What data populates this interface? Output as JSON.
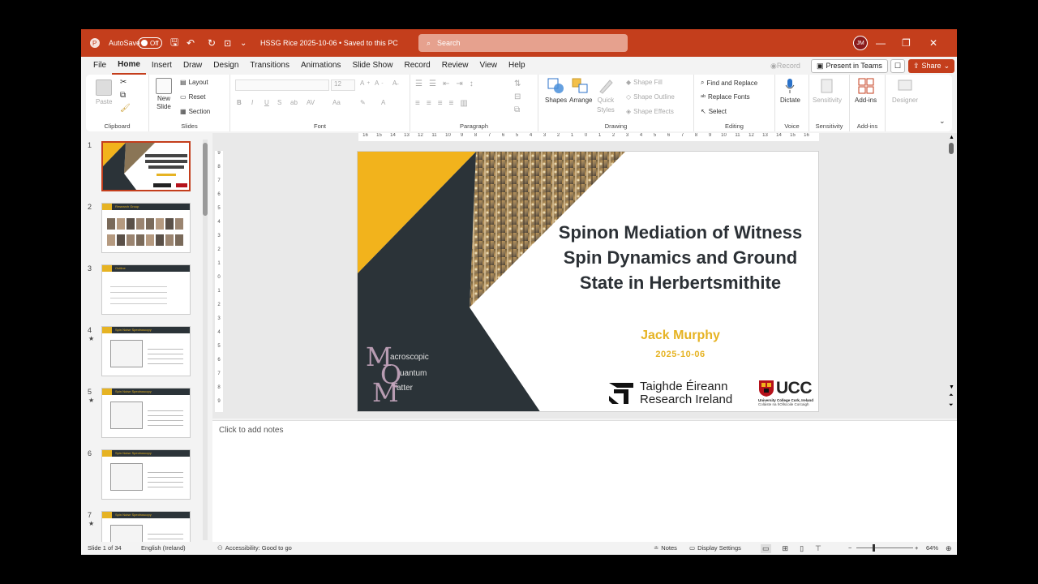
{
  "titlebar": {
    "autosave_label": "AutoSave",
    "autosave_state": "Off",
    "doc_title": "HSSG Rice 2025-10-06 • Saved to this PC",
    "search_placeholder": "Search",
    "user_initials": "JM",
    "minimize": "—",
    "restore": "❐",
    "close": "✕"
  },
  "menubar": {
    "tabs": [
      "File",
      "Home",
      "Insert",
      "Draw",
      "Design",
      "Transitions",
      "Animations",
      "Slide Show",
      "Record",
      "Review",
      "View",
      "Help"
    ],
    "active_tab": "Home",
    "record_label": "Record",
    "present_label": "Present in Teams",
    "share_label": "Share"
  },
  "ribbon": {
    "clipboard": {
      "paste": "Paste",
      "label": "Clipboard"
    },
    "slides": {
      "new_slide": "New",
      "new_slide_2": "Slide",
      "layout": "Layout",
      "reset": "Reset",
      "section": "Section",
      "label": "Slides"
    },
    "font": {
      "font_size": "12",
      "label": "Font"
    },
    "paragraph": {
      "label": "Paragraph"
    },
    "drawing": {
      "shapes": "Shapes",
      "arrange": "Arrange",
      "quick_styles": "Quick",
      "quick_styles_2": "Styles",
      "shape_fill": "Shape Fill",
      "shape_outline": "Shape Outline",
      "shape_effects": "Shape Effects",
      "label": "Drawing"
    },
    "editing": {
      "find_replace": "Find and Replace",
      "replace_fonts": "Replace Fonts",
      "select": "Select",
      "label": "Editing"
    },
    "voice": {
      "dictate": "Dictate",
      "label": "Voice"
    },
    "sensitivity": {
      "sensitivity": "Sensitivity",
      "label": "Sensitivity"
    },
    "addins": {
      "addins": "Add-ins",
      "label": "Add-ins"
    },
    "designer": {
      "designer": "Designer"
    }
  },
  "thumbnails": [
    {
      "num": "1",
      "star": "",
      "title": ""
    },
    {
      "num": "2",
      "star": "",
      "title": "Research Group"
    },
    {
      "num": "3",
      "star": "",
      "title": "Outline"
    },
    {
      "num": "4",
      "star": "★",
      "title": "Spin Noise Spectroscopy"
    },
    {
      "num": "5",
      "star": "★",
      "title": "Spin Noise Spectroscopy"
    },
    {
      "num": "6",
      "star": "",
      "title": "Spin Noise Spectroscopy"
    },
    {
      "num": "7",
      "star": "★",
      "title": "Spin Noise Spectroscopy"
    }
  ],
  "slide": {
    "title": "Spinon Mediation of Witness Spin Dynamics and Ground State in Herbertsmithite",
    "author": "Jack Murphy",
    "date": "2025-10-06",
    "mqm_line1": "acroscopic",
    "mqm_line2": "uantum",
    "mqm_line3": "atter",
    "mqm_m": "M",
    "mqm_q": "Q",
    "mqm_m2": "M",
    "funder_line1": "Taighde Éireann",
    "funder_line2": "Research Ireland",
    "ucc_name": "UCC",
    "ucc_sub1": "University College Cork, Ireland",
    "ucc_sub2": "Coláiste na hOllscoile Corcaigh"
  },
  "notes": {
    "placeholder": "Click to add notes"
  },
  "status": {
    "slide_of": "Slide 1 of 34",
    "language": "English (Ireland)",
    "accessibility": "Accessibility: Good to go",
    "notes": "Notes",
    "display_settings": "Display Settings",
    "zoom": "64%"
  },
  "colors": {
    "accent": "#c43e1c",
    "slide_dark": "#2b3338",
    "slide_yellow": "#e6b323"
  }
}
